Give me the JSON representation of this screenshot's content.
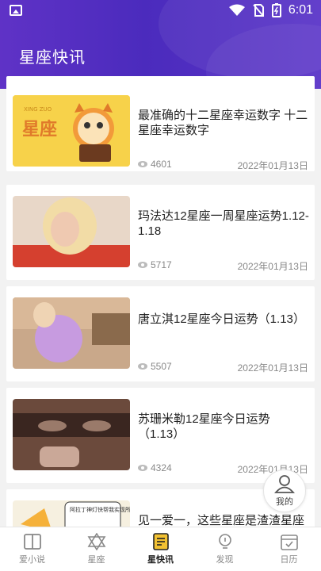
{
  "status": {
    "time": "6:01"
  },
  "header": {
    "title": "星座快讯"
  },
  "articles": [
    {
      "title": "最准确的十二星座幸运数字 十二星座幸运数字",
      "views": "4601",
      "date": "2022年01月13日"
    },
    {
      "title": "玛法达12星座一周星座运势1.12-1.18",
      "views": "5717",
      "date": "2022年01月13日"
    },
    {
      "title": "唐立淇12星座今日运势（1.13）",
      "views": "5507",
      "date": "2022年01月13日"
    },
    {
      "title": "苏珊米勒12星座今日运势（1.13）",
      "views": "4324",
      "date": "2022年01月13日"
    },
    {
      "title": "见一爱一，这些星座是渣渣星座",
      "views": "",
      "date": ""
    }
  ],
  "float_button": {
    "label": "我的"
  },
  "tabs": [
    {
      "label": "爱小说",
      "icon": "book-icon"
    },
    {
      "label": "星座",
      "icon": "star-of-david-icon"
    },
    {
      "label": "星快讯",
      "icon": "news-icon"
    },
    {
      "label": "发现",
      "icon": "bulb-icon"
    },
    {
      "label": "日历",
      "icon": "calendar-icon"
    }
  ],
  "active_tab": "星快讯",
  "colors": {
    "header": "#4b2bbd",
    "active_tab": "#222222",
    "inactive_tab": "#888888"
  },
  "thumbnail_texts": {
    "first": "星座",
    "first_small": "XING ZUO",
    "fifth": "阿拉丁神灯快帮我实现所有的愿望"
  }
}
